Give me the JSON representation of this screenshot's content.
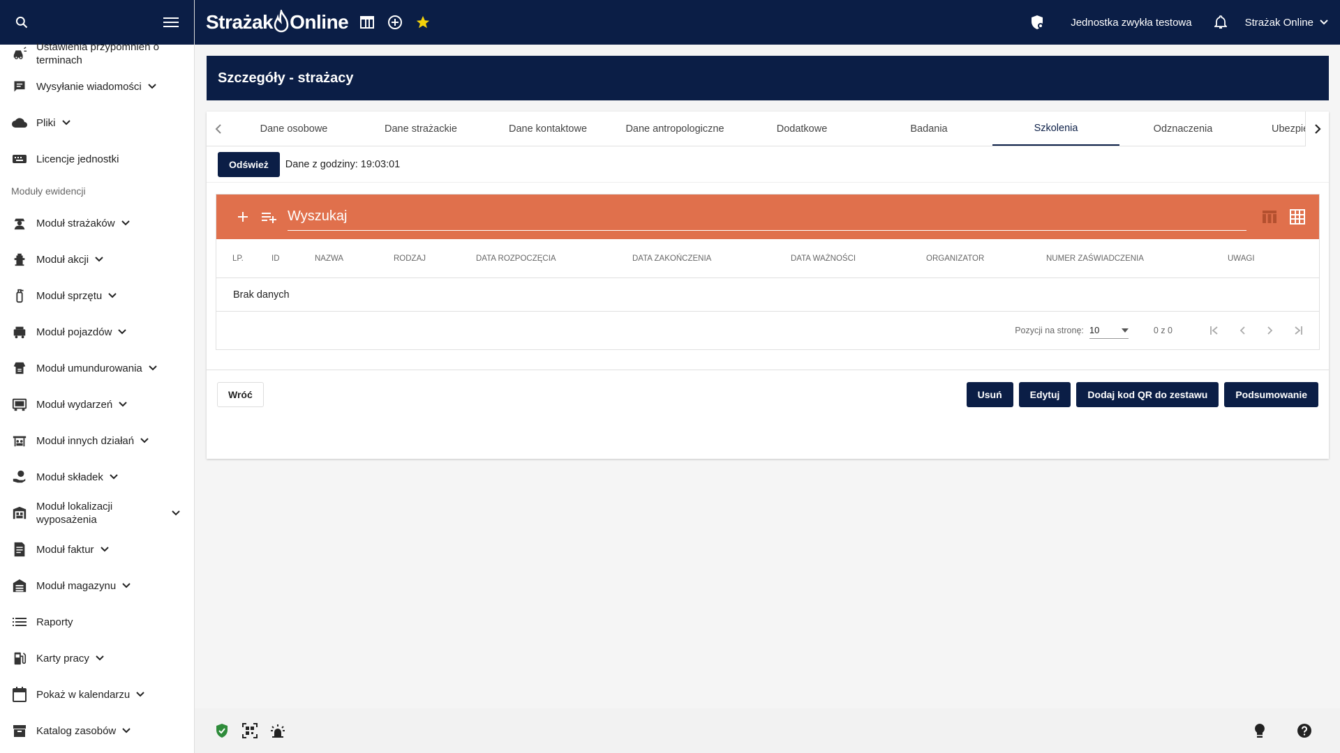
{
  "header": {
    "brand_left": "Strażak",
    "brand_right": "Online",
    "unit_name": "Jednostka zwykła testowa",
    "user_name": "Strażak Online"
  },
  "sidebar": {
    "items": [
      {
        "label_line1": "Ustawienia przypomnień o",
        "label_line2": "terminach",
        "icon": "car-alarm-icon"
      },
      {
        "label": "Wysyłanie wiadomości",
        "icon": "message-icon",
        "expandable": true
      },
      {
        "label": "Pliki",
        "icon": "cloud-icon",
        "expandable": true
      },
      {
        "label": "Licencje jednostki",
        "icon": "keyboard-icon"
      }
    ],
    "section_label": "Moduły ewidencji",
    "modules": [
      {
        "label": "Moduł strażaków",
        "icon": "firefighter-icon"
      },
      {
        "label": "Moduł akcji",
        "icon": "fire-hydrant-icon"
      },
      {
        "label": "Moduł sprzętu",
        "icon": "extinguisher-icon"
      },
      {
        "label": "Moduł pojazdów",
        "icon": "truck-icon"
      },
      {
        "label": "Moduł umundurowania",
        "icon": "uniform-icon"
      },
      {
        "label": "Moduł wydarzeń",
        "icon": "event-icon"
      },
      {
        "label": "Moduł innych działań",
        "icon": "other-actions-icon"
      },
      {
        "label": "Moduł składek",
        "icon": "fees-icon"
      },
      {
        "label_line1": "Moduł lokalizacji",
        "label_line2": "wyposażenia",
        "icon": "location-icon"
      },
      {
        "label": "Moduł faktur",
        "icon": "invoice-icon"
      },
      {
        "label": "Moduł magazynu",
        "icon": "warehouse-icon"
      },
      {
        "label": "Raporty",
        "icon": "list-icon",
        "expandable": false
      },
      {
        "label": "Karty pracy",
        "icon": "fuel-icon"
      },
      {
        "label": "Pokaż w kalendarzu",
        "icon": "calendar-icon"
      },
      {
        "label": "Katalog zasobów",
        "icon": "archive-icon"
      }
    ]
  },
  "page": {
    "title": "Szczegóły - strażacy",
    "tabs": [
      "Dane osobowe",
      "Dane strażackie",
      "Dane kontaktowe",
      "Dane antropologiczne",
      "Dodatkowe",
      "Badania",
      "Szkolenia",
      "Odznaczenia",
      "Ubezpieczenia"
    ],
    "active_tab": "Szkolenia",
    "refresh_label": "Odśwież",
    "data_time": "Dane z godziny: 19:03:01"
  },
  "table": {
    "search_placeholder": "Wyszukaj",
    "columns": [
      "LP.",
      "ID",
      "NAZWA",
      "RODZAJ",
      "DATA ROZPOCZĘCIA",
      "DATA ZAKOŃCZENIA",
      "DATA WAŻNOŚCI",
      "ORGANIZATOR",
      "NUMER ZAŚWIADCZENIA",
      "UWAGI"
    ],
    "empty_text": "Brak danych",
    "page_size_label": "Pozycji na stronę:",
    "page_size": "10",
    "range": "0 z 0"
  },
  "actions": {
    "back": "Wróć",
    "delete": "Usuń",
    "edit": "Edytuj",
    "add_qr": "Dodaj kod QR do zestawu",
    "summary": "Podsumowanie"
  },
  "colors": {
    "navy": "#0b1e46",
    "toolbar_orange": "#e0704c",
    "star": "#f5d20a",
    "shield_green": "#2e8b3a"
  }
}
